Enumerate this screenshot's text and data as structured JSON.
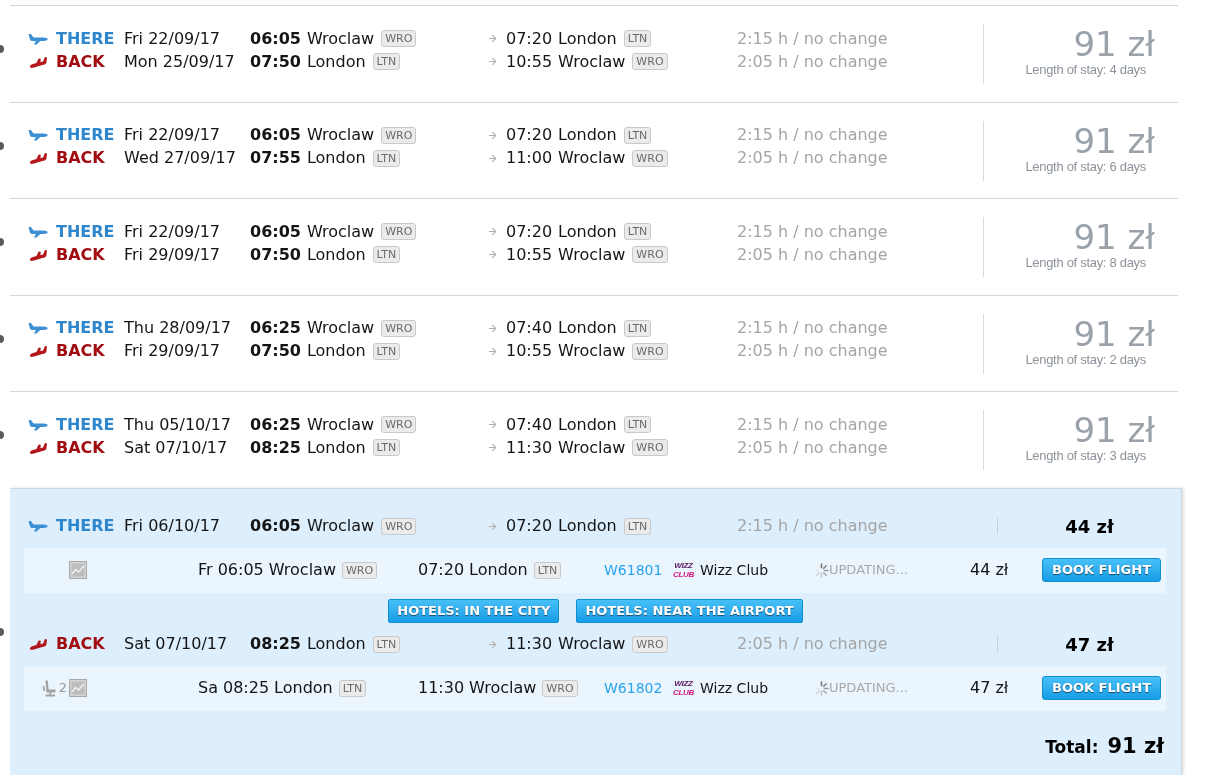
{
  "results": [
    {
      "expanded": false,
      "legs": [
        {
          "kind": "there",
          "label": "THERE",
          "date": "Fri 22/09/17",
          "dep_time": "06:05",
          "dep_city": "Wroclaw",
          "dep_code": "WRO",
          "arr_time": "07:20",
          "arr_city": "London",
          "arr_code": "LTN",
          "duration": "2:15 h / no change"
        },
        {
          "kind": "back",
          "label": "BACK",
          "date": "Mon 25/09/17",
          "dep_time": "07:50",
          "dep_city": "London",
          "dep_code": "LTN",
          "arr_time": "10:55",
          "arr_city": "Wroclaw",
          "arr_code": "WRO",
          "duration": "2:05 h / no change"
        }
      ],
      "price": "91 zł",
      "stay": "Length of stay: 4 days"
    },
    {
      "expanded": false,
      "legs": [
        {
          "kind": "there",
          "label": "THERE",
          "date": "Fri 22/09/17",
          "dep_time": "06:05",
          "dep_city": "Wroclaw",
          "dep_code": "WRO",
          "arr_time": "07:20",
          "arr_city": "London",
          "arr_code": "LTN",
          "duration": "2:15 h / no change"
        },
        {
          "kind": "back",
          "label": "BACK",
          "date": "Wed 27/09/17",
          "dep_time": "07:55",
          "dep_city": "London",
          "dep_code": "LTN",
          "arr_time": "11:00",
          "arr_city": "Wroclaw",
          "arr_code": "WRO",
          "duration": "2:05 h / no change"
        }
      ],
      "price": "91 zł",
      "stay": "Length of stay: 6 days"
    },
    {
      "expanded": false,
      "legs": [
        {
          "kind": "there",
          "label": "THERE",
          "date": "Fri 22/09/17",
          "dep_time": "06:05",
          "dep_city": "Wroclaw",
          "dep_code": "WRO",
          "arr_time": "07:20",
          "arr_city": "London",
          "arr_code": "LTN",
          "duration": "2:15 h / no change"
        },
        {
          "kind": "back",
          "label": "BACK",
          "date": "Fri 29/09/17",
          "dep_time": "07:50",
          "dep_city": "London",
          "dep_code": "LTN",
          "arr_time": "10:55",
          "arr_city": "Wroclaw",
          "arr_code": "WRO",
          "duration": "2:05 h / no change"
        }
      ],
      "price": "91 zł",
      "stay": "Length of stay: 8 days"
    },
    {
      "expanded": false,
      "legs": [
        {
          "kind": "there",
          "label": "THERE",
          "date": "Thu 28/09/17",
          "dep_time": "06:25",
          "dep_city": "Wroclaw",
          "dep_code": "WRO",
          "arr_time": "07:40",
          "arr_city": "London",
          "arr_code": "LTN",
          "duration": "2:15 h / no change"
        },
        {
          "kind": "back",
          "label": "BACK",
          "date": "Fri 29/09/17",
          "dep_time": "07:50",
          "dep_city": "London",
          "dep_code": "LTN",
          "arr_time": "10:55",
          "arr_city": "Wroclaw",
          "arr_code": "WRO",
          "duration": "2:05 h / no change"
        }
      ],
      "price": "91 zł",
      "stay": "Length of stay: 2 days"
    },
    {
      "expanded": false,
      "legs": [
        {
          "kind": "there",
          "label": "THERE",
          "date": "Thu 05/10/17",
          "dep_time": "06:25",
          "dep_city": "Wroclaw",
          "dep_code": "WRO",
          "arr_time": "07:40",
          "arr_city": "London",
          "arr_code": "LTN",
          "duration": "2:15 h / no change"
        },
        {
          "kind": "back",
          "label": "BACK",
          "date": "Sat 07/10/17",
          "dep_time": "08:25",
          "dep_city": "London",
          "dep_code": "LTN",
          "arr_time": "11:30",
          "arr_city": "Wroclaw",
          "arr_code": "WRO",
          "duration": "2:05 h / no change"
        }
      ],
      "price": "91 zł",
      "stay": "Length of stay: 3 days"
    },
    {
      "expanded": true,
      "legs": [
        {
          "kind": "there",
          "label": "THERE",
          "date": "Fri 06/10/17",
          "dep_time": "06:05",
          "dep_city": "Wroclaw",
          "dep_code": "WRO",
          "arr_time": "07:20",
          "arr_city": "London",
          "arr_code": "LTN",
          "duration": "2:15 h / no change",
          "price": "44 zł",
          "flight": {
            "day": "Fr",
            "dep_time": "06:05",
            "dep_city": "Wroclaw",
            "dep_code": "WRO",
            "arr_time": "07:20",
            "arr_city": "London",
            "arr_code": "LTN",
            "number": "W61801",
            "airline_logo": [
              "WIZZ",
              "CLUB"
            ],
            "airline": "Wizz Club",
            "status": "UPDATING...",
            "price": "44 zł",
            "button": "BOOK FLIGHT"
          },
          "hotels": [
            "HOTELS: IN THE CITY",
            "HOTELS: NEAR THE AIRPORT"
          ]
        },
        {
          "kind": "back",
          "label": "BACK",
          "date": "Sat 07/10/17",
          "dep_time": "08:25",
          "dep_city": "London",
          "dep_code": "LTN",
          "arr_time": "11:30",
          "arr_city": "Wroclaw",
          "arr_code": "WRO",
          "duration": "2:05 h / no change",
          "price": "47 zł",
          "flight": {
            "seats": "2",
            "day": "Sa",
            "dep_time": "08:25",
            "dep_city": "London",
            "dep_code": "LTN",
            "arr_time": "11:30",
            "arr_city": "Wroclaw",
            "arr_code": "WRO",
            "number": "W61802",
            "airline_logo": [
              "WIZZ",
              "CLUB"
            ],
            "airline": "Wizz Club",
            "status": "UPDATING...",
            "price": "47 zł",
            "button": "BOOK FLIGHT"
          }
        }
      ],
      "total_label": "Total:",
      "total": "91 zł"
    }
  ]
}
